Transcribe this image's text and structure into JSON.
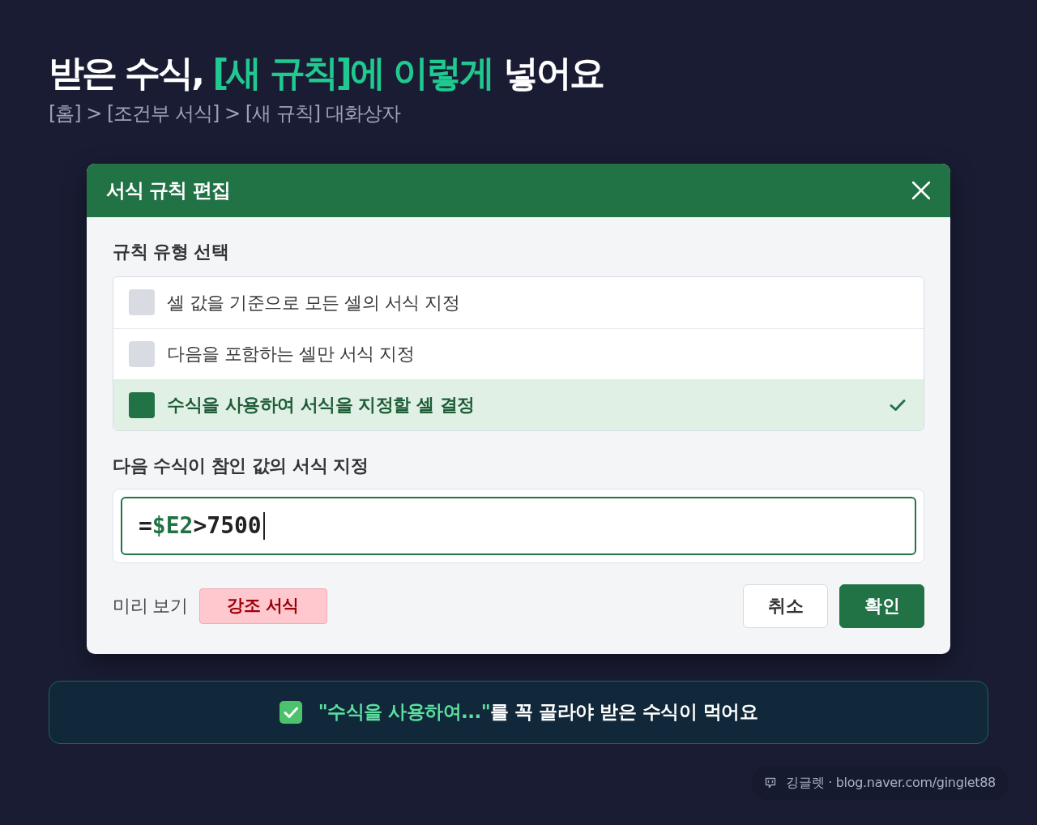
{
  "header": {
    "title": [
      {
        "text": "받은 수식, ",
        "highlight": false
      },
      {
        "text": "[새 규칙]에 이렇게",
        "highlight": true
      },
      {
        "text": " 넣어요",
        "highlight": false
      }
    ],
    "breadcrumb": "[홈] > [조건부 서식] > [새 규칙] 대화상자"
  },
  "dialog": {
    "title": "서식 규칙 편집",
    "rule_type": {
      "label": "규칙 유형 선택",
      "options": [
        {
          "label": "셀 값을 기준으로 모든 셀의 서식 지정",
          "selected": false
        },
        {
          "label": "다음을 포함하는 셀만 서식 지정",
          "selected": false
        },
        {
          "label": "수식을 사용하여 서식을 지정할 셀 결정",
          "selected": true
        }
      ]
    },
    "formula": {
      "label": "다음 수식이 참인 값의 서식 지정",
      "focused": true,
      "value": [
        {
          "text": "=",
          "highlight": false
        },
        {
          "text": "$E2",
          "highlight": true
        },
        {
          "text": ">7500",
          "highlight": false
        }
      ]
    },
    "preview": {
      "label": "미리 보기",
      "sample": "강조 서식"
    },
    "buttons": [
      {
        "label": "취소",
        "kind": "secondary"
      },
      {
        "label": "확인",
        "kind": "primary"
      }
    ]
  },
  "tip": {
    "text": [
      {
        "text": "\"수식을 사용하여...\"",
        "highlight": true
      },
      {
        "text": "를 꼭 골라야 받은 수식이 먹어요",
        "highlight": false
      }
    ]
  },
  "credit": "깅글렛 · blog.naver.com/ginglet88"
}
